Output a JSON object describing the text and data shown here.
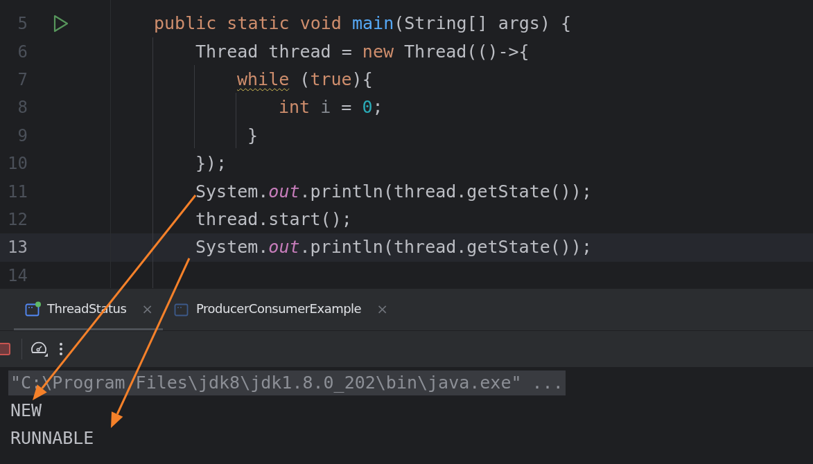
{
  "editor": {
    "lines": [
      {
        "number": "5",
        "run_marker": true,
        "current": false,
        "tokens": [
          {
            "kind": "keyword",
            "text": "public static void "
          },
          {
            "kind": "method",
            "text": "main"
          },
          {
            "kind": "plain",
            "text": "(String[] args) {"
          }
        ],
        "children": [
          {
            "number": "6",
            "run_marker": false,
            "current": false,
            "tokens": [
              {
                "kind": "plain",
                "text": "Thread thread = "
              },
              {
                "kind": "keyword",
                "text": "new "
              },
              {
                "kind": "plain",
                "text": "Thread(()->{"
              }
            ],
            "children": [
              {
                "number": "7",
                "run_marker": false,
                "current": false,
                "tokens": [
                  {
                    "kind": "keyword",
                    "text": "while",
                    "warning": true
                  },
                  {
                    "kind": "plain",
                    "text": " ("
                  },
                  {
                    "kind": "keyword",
                    "text": "true"
                  },
                  {
                    "kind": "plain",
                    "text": "){"
                  }
                ],
                "children": [
                  {
                    "number": "8",
                    "run_marker": false,
                    "current": false,
                    "tokens": [
                      {
                        "kind": "keyword",
                        "text": "int "
                      },
                      {
                        "kind": "unused",
                        "text": "i"
                      },
                      {
                        "kind": "plain",
                        "text": " = "
                      },
                      {
                        "kind": "number",
                        "text": "0"
                      },
                      {
                        "kind": "plain",
                        "text": ";"
                      }
                    ]
                  }
                ]
              },
              {
                "number": "9",
                "run_marker": false,
                "current": false,
                "tokens": [
                  {
                    "kind": "plain",
                    "text": " }"
                  }
                ]
              }
            ]
          },
          {
            "number": "10",
            "run_marker": false,
            "current": false,
            "tokens": [
              {
                "kind": "plain",
                "text": "});"
              }
            ]
          },
          {
            "number": "11",
            "run_marker": false,
            "current": false,
            "tokens": [
              {
                "kind": "plain",
                "text": "System."
              },
              {
                "kind": "field",
                "text": "out"
              },
              {
                "kind": "plain",
                "text": ".println(thread.getState());"
              }
            ]
          },
          {
            "number": "12",
            "run_marker": false,
            "current": false,
            "tokens": [
              {
                "kind": "plain",
                "text": "thread.start();"
              }
            ]
          },
          {
            "number": "13",
            "run_marker": false,
            "current": true,
            "tokens": [
              {
                "kind": "plain",
                "text": "System."
              },
              {
                "kind": "field",
                "text": "out"
              },
              {
                "kind": "plain",
                "text": ".println(thread.getState());"
              }
            ]
          }
        ]
      },
      {
        "number": "14",
        "run_marker": false,
        "current": false
      }
    ]
  },
  "run_tabs": [
    {
      "label": "ThreadStatus",
      "close": "×",
      "selected": true,
      "running": true
    },
    {
      "label": "ProducerConsumerExample",
      "close": "×",
      "selected": false,
      "running": false
    }
  ],
  "console": {
    "lines": [
      {
        "kind": "command",
        "text": "\"C:\\Program Files\\jdk8\\jdk1.8.0_202\\bin\\java.exe\" ..."
      },
      {
        "kind": "output",
        "text": "NEW"
      },
      {
        "kind": "output",
        "text": "RUNNABLE"
      }
    ]
  }
}
